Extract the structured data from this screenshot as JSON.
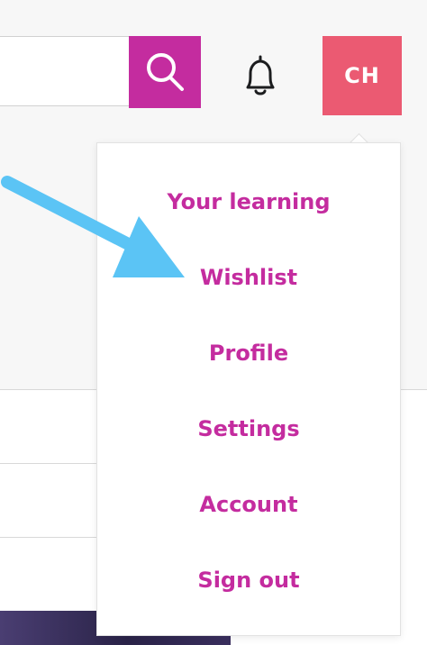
{
  "header": {
    "search": {
      "placeholder": "",
      "value": ""
    },
    "search_icon": "search-icon",
    "bell_icon": "bell-icon",
    "avatar_initials": "CH"
  },
  "user_menu": {
    "items": [
      {
        "label": "Your learning"
      },
      {
        "label": "Wishlist"
      },
      {
        "label": "Profile"
      },
      {
        "label": "Settings"
      },
      {
        "label": "Account"
      },
      {
        "label": "Sign out"
      }
    ]
  },
  "annotation": {
    "arrow_icon": "pointer-arrow-icon",
    "points_to": "Wishlist"
  },
  "colors": {
    "accent": "#c42c9f",
    "avatar_bg": "#eb5a72",
    "arrow": "#5bc4f5",
    "header_bg": "#f7f7f7"
  }
}
